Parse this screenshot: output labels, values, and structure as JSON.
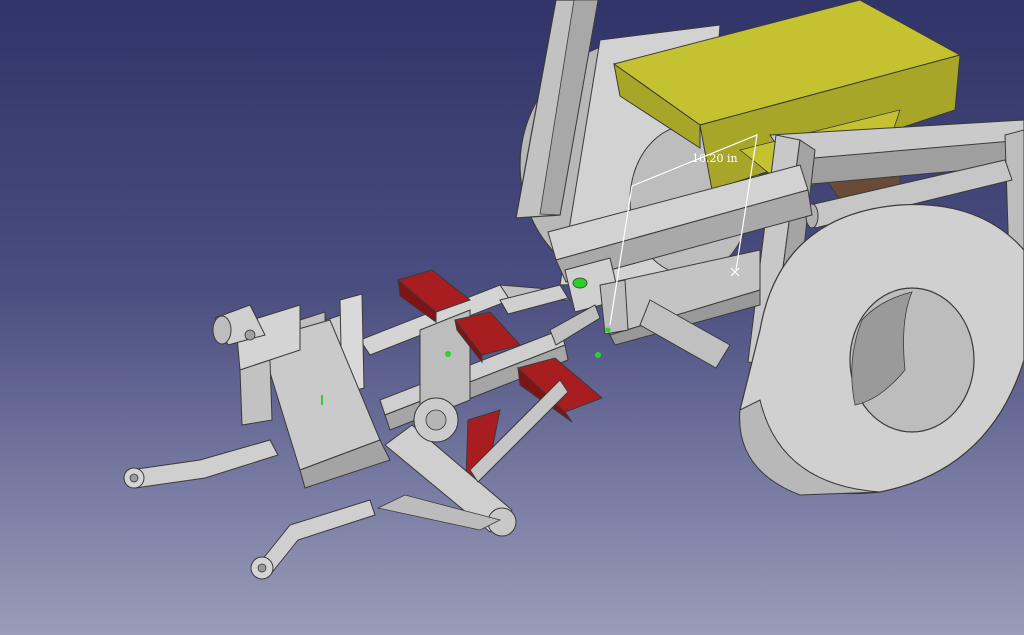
{
  "viewer": {
    "background_top": "#313468",
    "background_bottom": "#9a9cb8"
  },
  "model": {
    "colors": {
      "body": "#c8c8c8",
      "body_shade": "#a9a9a9",
      "body_dark": "#8c8c8c",
      "selected": "#c4c230",
      "selected_shade": "#a8a628",
      "highlight_red": "#a81d20",
      "highlight_red_dark": "#7e1416",
      "edge": "#3a3a3a",
      "marker_green": "#2bd12b",
      "seat_brown": "#6a4a38"
    }
  },
  "measurement": {
    "label": "16.20 in",
    "color": "#ffffff"
  }
}
